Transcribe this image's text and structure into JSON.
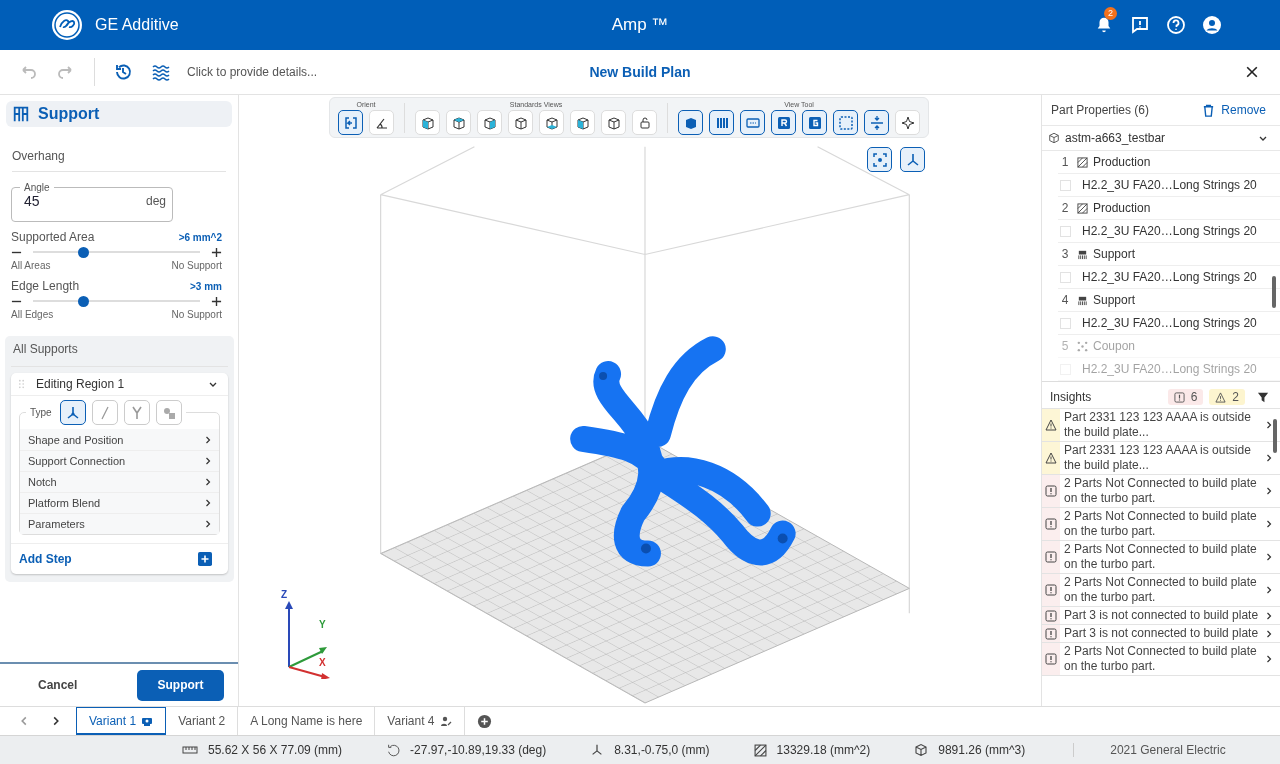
{
  "header": {
    "brand": "GE Additive",
    "app_title": "Amp ™",
    "notification_count": "2"
  },
  "toolbar": {
    "title": "New Build Plan",
    "details_placeholder": "Click to provide details..."
  },
  "left_panel": {
    "title": "Support",
    "section": "Overhang",
    "angle": {
      "label": "Angle",
      "value": "45",
      "unit": "deg"
    },
    "sliders": [
      {
        "label": "Supported Area",
        "reading": ">6 mm^2",
        "min_label": "All Areas",
        "max_label": "No Support",
        "level": 0.3
      },
      {
        "label": "Edge Length",
        "reading": ">3 mm",
        "min_label": "All Edges",
        "max_label": "No Support",
        "level": 0.3
      }
    ],
    "all_supports": {
      "title": "All Supports",
      "region": "Editing Region 1",
      "type_label": "Type",
      "type_options": [
        {
          "kind": "tree",
          "selected": true
        },
        {
          "kind": "line",
          "selected": false
        },
        {
          "kind": "fork",
          "selected": false
        },
        {
          "kind": "block",
          "selected": false
        }
      ],
      "menu": [
        "Shape and Position",
        "Support Connection",
        "Notch",
        "Platform Blend",
        "Parameters"
      ],
      "add_step": "Add Step"
    },
    "buttons": {
      "cancel": "Cancel",
      "confirm": "Support"
    }
  },
  "view_toolbar": {
    "groups": [
      {
        "label": "Orient",
        "tools": [
          {
            "selected": true
          },
          {
            "selected": false
          }
        ]
      },
      {
        "label": "Standards Views",
        "tools": [
          {
            "selected": false
          },
          {
            "selected": false
          },
          {
            "selected": false
          },
          {
            "selected": false
          },
          {
            "selected": false
          },
          {
            "selected": false
          },
          {
            "selected": false
          },
          {
            "selected": false
          }
        ]
      },
      {
        "label": "View Tool",
        "tools": [
          {
            "selected": true
          },
          {
            "selected": true
          },
          {
            "selected": true
          },
          {
            "selected": true
          },
          {
            "selected": true
          },
          {
            "selected": true
          },
          {
            "selected": true
          },
          {
            "selected": false
          }
        ]
      }
    ],
    "extra_tools": [
      {
        "selected": true
      },
      {
        "selected": true
      }
    ]
  },
  "axes": {
    "z": "Z",
    "y": "Y",
    "x": "X"
  },
  "part_properties": {
    "title": "Part Properties (6)",
    "remove": "Remove",
    "part": "astm-a663_testbar",
    "items": [
      {
        "index": "1",
        "kind": "production",
        "type": "Production",
        "name": "H2.2_3U FA20…Long Strings 20",
        "checked": false
      },
      {
        "index": "2",
        "kind": "production",
        "type": "Production",
        "name": "H2.2_3U FA20…Long Strings 20",
        "checked": false
      },
      {
        "index": "3",
        "kind": "support",
        "type": "Support",
        "name": "H2.2_3U FA20…Long Strings 20",
        "checked": false
      },
      {
        "index": "4",
        "kind": "support",
        "type": "Support",
        "name": "H2.2_3U FA20…Long Strings 20",
        "checked": false
      },
      {
        "index": "5",
        "kind": "coupon",
        "type": "Coupon",
        "name": "H2.2_3U FA20…Long Strings 20",
        "checked": false
      }
    ]
  },
  "insights": {
    "title": "Insights",
    "error_count": "6",
    "warning_count": "2",
    "items": [
      {
        "kind": "warning",
        "text": "Part 2331 123 123 AAAA is outside the build plate..."
      },
      {
        "kind": "warning",
        "text": "Part 2331 123 123 AAAA is outside the build plate..."
      },
      {
        "kind": "error",
        "text": "2 Parts Not Connected to build plate on the turbo part."
      },
      {
        "kind": "error",
        "text": "2 Parts Not Connected to build plate on the turbo part."
      },
      {
        "kind": "error",
        "text": "2 Parts Not Connected to build plate on the turbo part."
      },
      {
        "kind": "error",
        "text": "2 Parts Not Connected to build plate on the turbo part."
      },
      {
        "kind": "error",
        "text": "Part 3 is not connected to build plate"
      },
      {
        "kind": "error",
        "text": "Part 3 is not connected to build plate"
      },
      {
        "kind": "error",
        "text": "2 Parts Not Connected to build plate on the turbo part."
      }
    ]
  },
  "variant_tabs": [
    {
      "label": "Variant 1",
      "kind": "printer",
      "selected": true
    },
    {
      "label": "Variant 2",
      "kind": "plain",
      "selected": false
    },
    {
      "label": "A Long Name is here",
      "kind": "plain",
      "selected": false
    },
    {
      "label": "Variant 4",
      "kind": "user",
      "selected": false
    }
  ],
  "status_bar": {
    "items": [
      {
        "kind": "dimensions",
        "text": "55.62 X 56 X 77.09 (mm)"
      },
      {
        "kind": "rotation",
        "text": "-27.97,-10.89,19.33 (deg)"
      },
      {
        "kind": "position",
        "text": "8.31,-0.75,0 (mm)"
      },
      {
        "kind": "area",
        "text": "13329.18 (mm^2)"
      },
      {
        "kind": "volume",
        "text": "9891.26 (mm^3)"
      }
    ],
    "copyright": "2021 General Electric"
  }
}
